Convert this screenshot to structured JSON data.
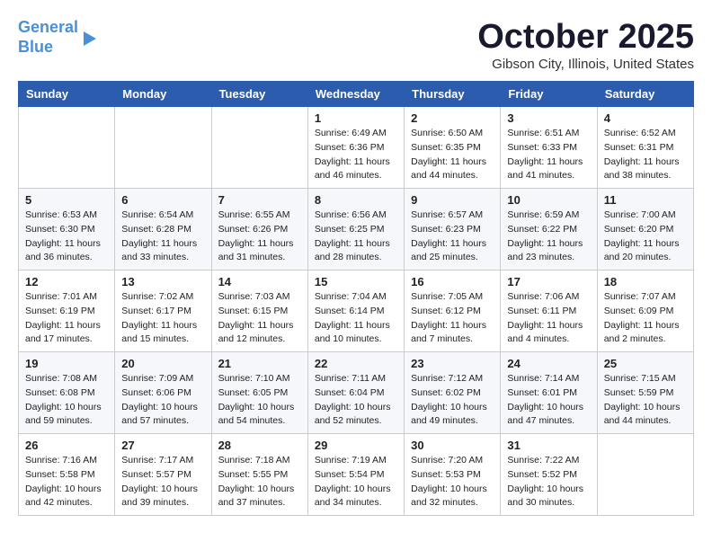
{
  "logo": {
    "line1": "General",
    "line2": "Blue",
    "arrow": true
  },
  "header": {
    "month": "October 2025",
    "location": "Gibson City, Illinois, United States"
  },
  "days_of_week": [
    "Sunday",
    "Monday",
    "Tuesday",
    "Wednesday",
    "Thursday",
    "Friday",
    "Saturday"
  ],
  "weeks": [
    [
      {
        "day": "",
        "info": ""
      },
      {
        "day": "",
        "info": ""
      },
      {
        "day": "",
        "info": ""
      },
      {
        "day": "1",
        "info": "Sunrise: 6:49 AM\nSunset: 6:36 PM\nDaylight: 11 hours and 46 minutes."
      },
      {
        "day": "2",
        "info": "Sunrise: 6:50 AM\nSunset: 6:35 PM\nDaylight: 11 hours and 44 minutes."
      },
      {
        "day": "3",
        "info": "Sunrise: 6:51 AM\nSunset: 6:33 PM\nDaylight: 11 hours and 41 minutes."
      },
      {
        "day": "4",
        "info": "Sunrise: 6:52 AM\nSunset: 6:31 PM\nDaylight: 11 hours and 38 minutes."
      }
    ],
    [
      {
        "day": "5",
        "info": "Sunrise: 6:53 AM\nSunset: 6:30 PM\nDaylight: 11 hours and 36 minutes."
      },
      {
        "day": "6",
        "info": "Sunrise: 6:54 AM\nSunset: 6:28 PM\nDaylight: 11 hours and 33 minutes."
      },
      {
        "day": "7",
        "info": "Sunrise: 6:55 AM\nSunset: 6:26 PM\nDaylight: 11 hours and 31 minutes."
      },
      {
        "day": "8",
        "info": "Sunrise: 6:56 AM\nSunset: 6:25 PM\nDaylight: 11 hours and 28 minutes."
      },
      {
        "day": "9",
        "info": "Sunrise: 6:57 AM\nSunset: 6:23 PM\nDaylight: 11 hours and 25 minutes."
      },
      {
        "day": "10",
        "info": "Sunrise: 6:59 AM\nSunset: 6:22 PM\nDaylight: 11 hours and 23 minutes."
      },
      {
        "day": "11",
        "info": "Sunrise: 7:00 AM\nSunset: 6:20 PM\nDaylight: 11 hours and 20 minutes."
      }
    ],
    [
      {
        "day": "12",
        "info": "Sunrise: 7:01 AM\nSunset: 6:19 PM\nDaylight: 11 hours and 17 minutes."
      },
      {
        "day": "13",
        "info": "Sunrise: 7:02 AM\nSunset: 6:17 PM\nDaylight: 11 hours and 15 minutes."
      },
      {
        "day": "14",
        "info": "Sunrise: 7:03 AM\nSunset: 6:15 PM\nDaylight: 11 hours and 12 minutes."
      },
      {
        "day": "15",
        "info": "Sunrise: 7:04 AM\nSunset: 6:14 PM\nDaylight: 11 hours and 10 minutes."
      },
      {
        "day": "16",
        "info": "Sunrise: 7:05 AM\nSunset: 6:12 PM\nDaylight: 11 hours and 7 minutes."
      },
      {
        "day": "17",
        "info": "Sunrise: 7:06 AM\nSunset: 6:11 PM\nDaylight: 11 hours and 4 minutes."
      },
      {
        "day": "18",
        "info": "Sunrise: 7:07 AM\nSunset: 6:09 PM\nDaylight: 11 hours and 2 minutes."
      }
    ],
    [
      {
        "day": "19",
        "info": "Sunrise: 7:08 AM\nSunset: 6:08 PM\nDaylight: 10 hours and 59 minutes."
      },
      {
        "day": "20",
        "info": "Sunrise: 7:09 AM\nSunset: 6:06 PM\nDaylight: 10 hours and 57 minutes."
      },
      {
        "day": "21",
        "info": "Sunrise: 7:10 AM\nSunset: 6:05 PM\nDaylight: 10 hours and 54 minutes."
      },
      {
        "day": "22",
        "info": "Sunrise: 7:11 AM\nSunset: 6:04 PM\nDaylight: 10 hours and 52 minutes."
      },
      {
        "day": "23",
        "info": "Sunrise: 7:12 AM\nSunset: 6:02 PM\nDaylight: 10 hours and 49 minutes."
      },
      {
        "day": "24",
        "info": "Sunrise: 7:14 AM\nSunset: 6:01 PM\nDaylight: 10 hours and 47 minutes."
      },
      {
        "day": "25",
        "info": "Sunrise: 7:15 AM\nSunset: 5:59 PM\nDaylight: 10 hours and 44 minutes."
      }
    ],
    [
      {
        "day": "26",
        "info": "Sunrise: 7:16 AM\nSunset: 5:58 PM\nDaylight: 10 hours and 42 minutes."
      },
      {
        "day": "27",
        "info": "Sunrise: 7:17 AM\nSunset: 5:57 PM\nDaylight: 10 hours and 39 minutes."
      },
      {
        "day": "28",
        "info": "Sunrise: 7:18 AM\nSunset: 5:55 PM\nDaylight: 10 hours and 37 minutes."
      },
      {
        "day": "29",
        "info": "Sunrise: 7:19 AM\nSunset: 5:54 PM\nDaylight: 10 hours and 34 minutes."
      },
      {
        "day": "30",
        "info": "Sunrise: 7:20 AM\nSunset: 5:53 PM\nDaylight: 10 hours and 32 minutes."
      },
      {
        "day": "31",
        "info": "Sunrise: 7:22 AM\nSunset: 5:52 PM\nDaylight: 10 hours and 30 minutes."
      },
      {
        "day": "",
        "info": ""
      }
    ]
  ]
}
